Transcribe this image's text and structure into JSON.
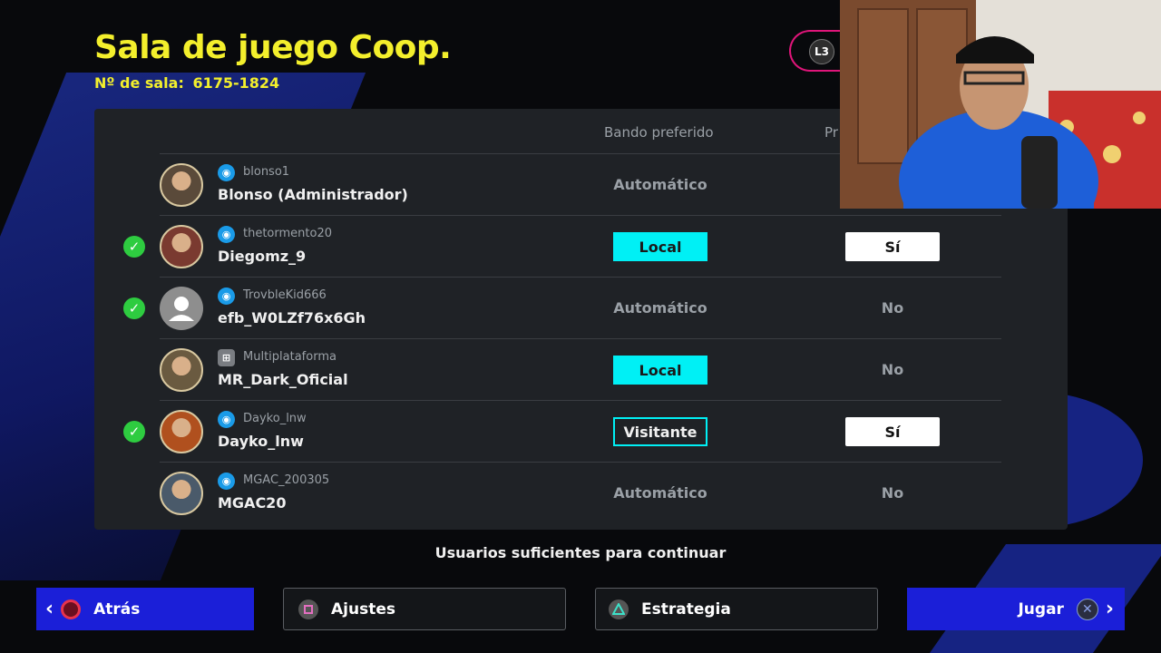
{
  "header": {
    "title": "Sala de juego Coop.",
    "room_label": "Nº de sala:",
    "room_number": "6175-1824",
    "l3_badge": "L3"
  },
  "columns": {
    "side": "Bando preferido",
    "pref": "Pr"
  },
  "players": [
    {
      "ready": false,
      "platform": "psn",
      "id": "blonso1",
      "name": "Blonso (Administrador)",
      "side": "Automático",
      "side_style": "text",
      "pref": "",
      "pref_style": "none"
    },
    {
      "ready": true,
      "platform": "psn",
      "id": "thetormento20",
      "name": "Diegomz_9",
      "side": "Local",
      "side_style": "local",
      "pref": "Sí",
      "pref_style": "yes"
    },
    {
      "ready": true,
      "platform": "psn",
      "id": "TrovbleKid666",
      "name": "efb_W0LZf76x6Gh",
      "side": "Automático",
      "side_style": "text",
      "pref": "No",
      "pref_style": "no"
    },
    {
      "ready": false,
      "platform": "multi",
      "id": "Multiplataforma",
      "name": "MR_Dark_Oficial",
      "side": "Local",
      "side_style": "local",
      "pref": "No",
      "pref_style": "no"
    },
    {
      "ready": true,
      "platform": "psn",
      "id": "Dayko_lnw",
      "name": "Dayko_lnw",
      "side": "Visitante",
      "side_style": "visit",
      "pref": "Sí",
      "pref_style": "yes"
    },
    {
      "ready": false,
      "platform": "psn",
      "id": "MGAC_200305",
      "name": "MGAC20",
      "side": "Automático",
      "side_style": "text",
      "pref": "No",
      "pref_style": "no"
    }
  ],
  "status_message": "Usuarios suficientes para continuar",
  "buttons": {
    "back": "Atrás",
    "settings": "Ajustes",
    "strategy": "Estrategia",
    "play": "Jugar"
  },
  "colors": {
    "title": "#f3ef2c",
    "accent_cyan": "#00f0f5",
    "button_blue": "#1b1fd8",
    "ready_green": "#2ecc40"
  }
}
